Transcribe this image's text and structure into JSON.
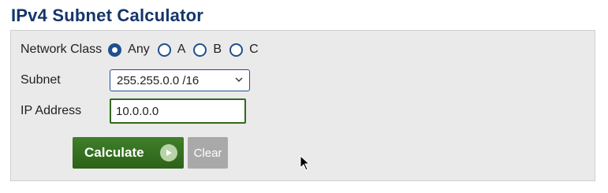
{
  "page": {
    "title": "IPv4 Subnet Calculator"
  },
  "form": {
    "network_class": {
      "label": "Network Class",
      "selected": "Any",
      "options": [
        "Any",
        "A",
        "B",
        "C"
      ]
    },
    "subnet": {
      "label": "Subnet",
      "value": "255.255.0.0 /16"
    },
    "ip_address": {
      "label": "IP Address",
      "value": "10.0.0.0"
    },
    "buttons": {
      "calculate": "Calculate",
      "clear": "Clear"
    }
  },
  "colors": {
    "title": "#14356b",
    "radio_accent": "#1f4f8f",
    "calculate_button": "#346f20",
    "clear_button": "#a9a9a9",
    "panel_background": "#eaeaea"
  },
  "icons": {
    "calculate": "play-circle-icon",
    "subnet_dropdown": "chevron-down-icon",
    "pointer": "mouse-cursor-icon"
  }
}
